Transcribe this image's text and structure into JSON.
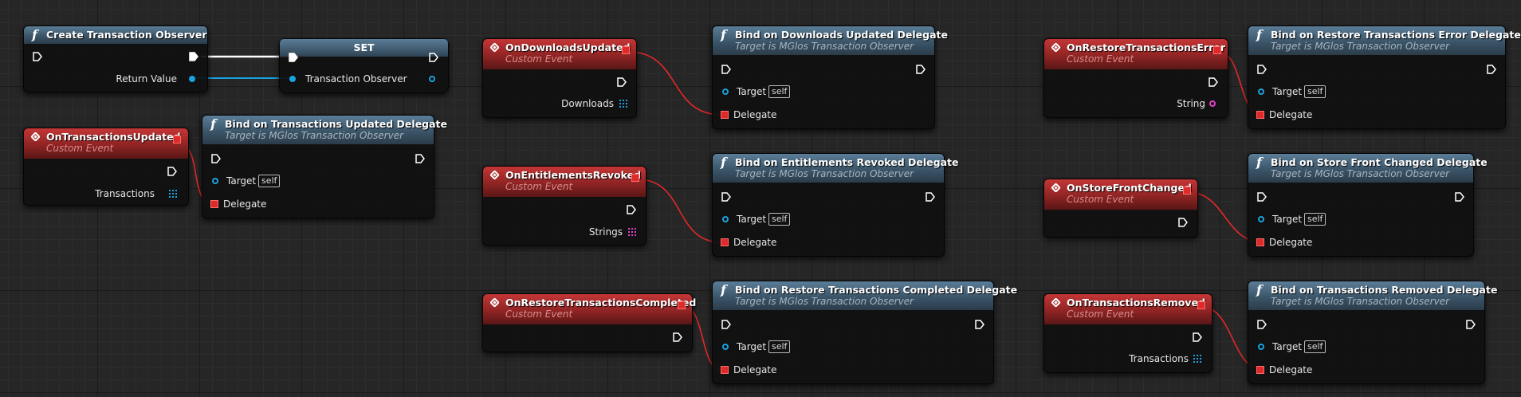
{
  "create_node": {
    "title": "Create Transaction Observer",
    "return_label": "Return Value"
  },
  "set_node": {
    "title": "SET",
    "pin_label": "Transaction Observer"
  },
  "events": [
    {
      "title": "OnTransactionsUpdated",
      "subtitle": "Custom Event",
      "output_label": "Transactions"
    },
    {
      "title": "OnDownloadsUpdated",
      "subtitle": "Custom Event",
      "output_label": "Downloads"
    },
    {
      "title": "OnEntitlementsRevoked",
      "subtitle": "Custom Event",
      "output_label": "Strings"
    },
    {
      "title": "OnRestoreTransactionsCompleted",
      "subtitle": "Custom Event",
      "output_label": ""
    },
    {
      "title": "OnRestoreTransactionsError",
      "subtitle": "Custom Event",
      "output_label": "String"
    },
    {
      "title": "OnStoreFrontChanged",
      "subtitle": "Custom Event",
      "output_label": ""
    },
    {
      "title": "OnTransactionsRemoved",
      "subtitle": "Custom Event",
      "output_label": "Transactions"
    }
  ],
  "binds": [
    {
      "title": "Bind on Transactions Updated Delegate"
    },
    {
      "title": "Bind on Downloads Updated Delegate"
    },
    {
      "title": "Bind on Entitlements Revoked Delegate"
    },
    {
      "title": "Bind on Restore Transactions Completed Delegate"
    },
    {
      "title": "Bind on Restore Transactions Error Delegate"
    },
    {
      "title": "Bind on Store Front Changed Delegate"
    },
    {
      "title": "Bind on Transactions Removed Delegate"
    }
  ],
  "bind_common": {
    "subtitle": "Target is MGlos Transaction Observer",
    "target_label": "Target",
    "self_label": "self",
    "delegate_label": "Delegate"
  },
  "colors": {
    "exec_wire": "#ffffff",
    "object_pin": "#1aa2e0",
    "delegate_pin": "#e02929",
    "string_pin": "#e040c8",
    "function_header": "#3b5568",
    "event_header": "#902424"
  },
  "icons": {
    "function": "function-f-icon",
    "event": "event-diamond-icon",
    "exec": "exec-arrow-icon",
    "array": "array-grid-icon"
  }
}
